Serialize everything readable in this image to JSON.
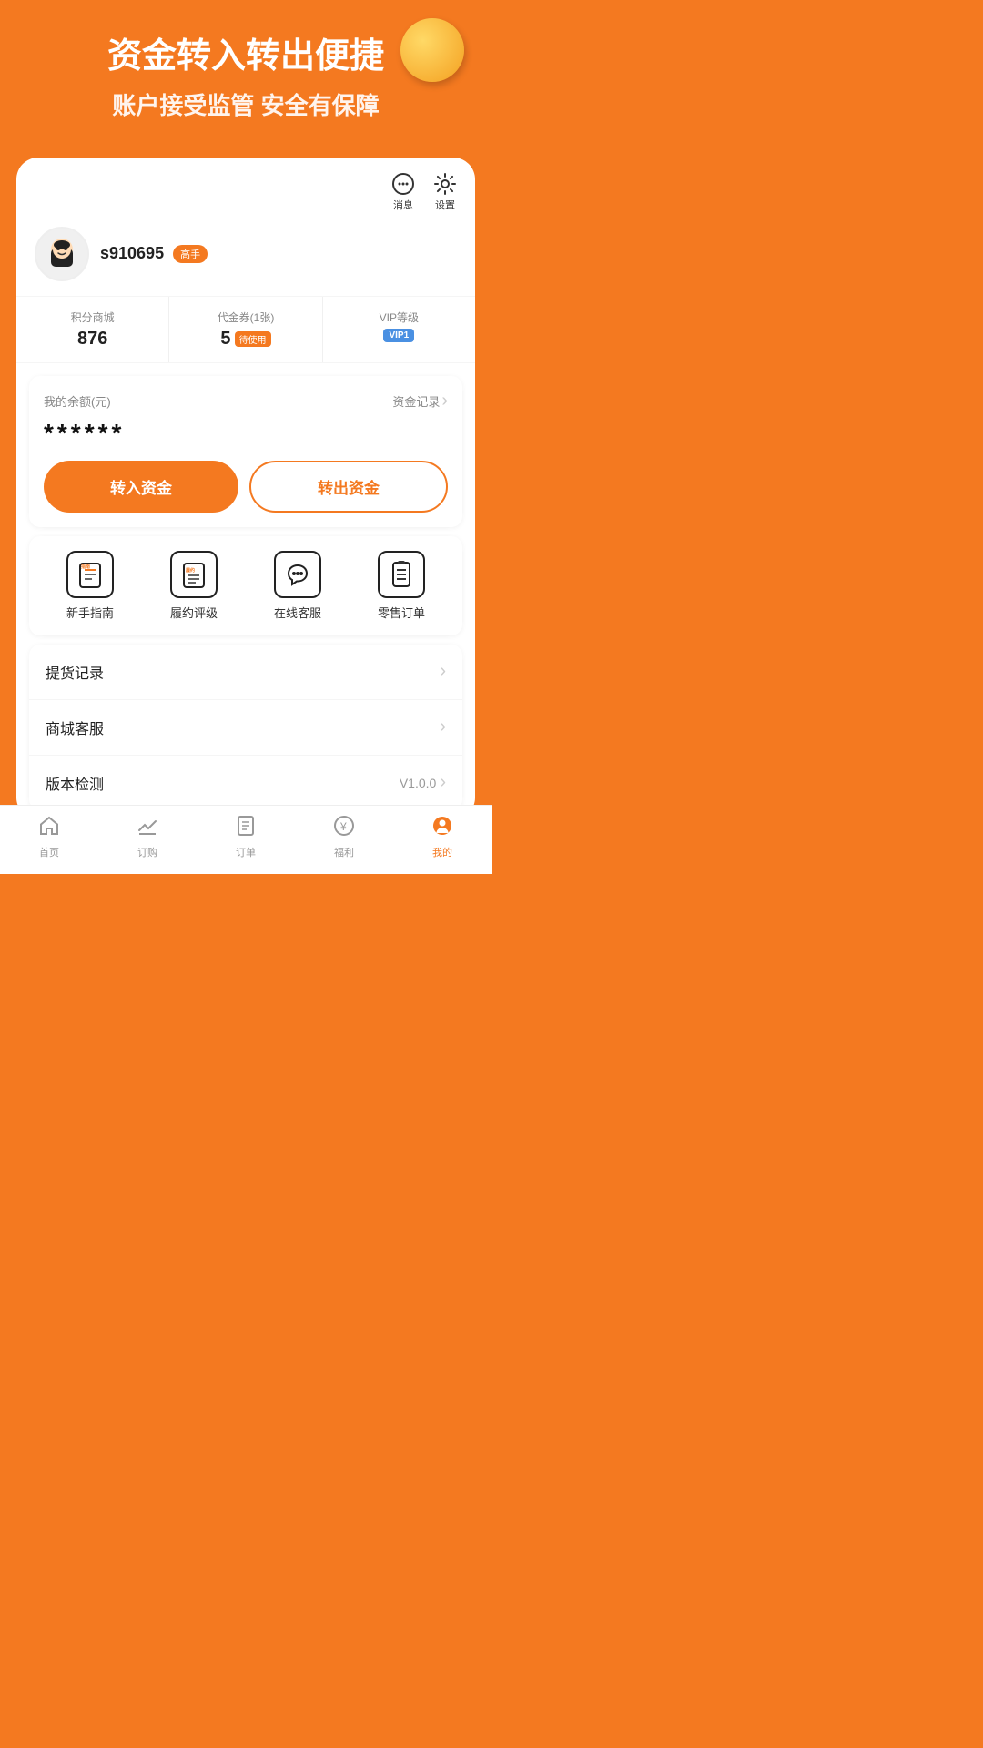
{
  "header": {
    "title": "资金转入转出便捷",
    "subtitle": "账户接受监管 安全有保障"
  },
  "icons": {
    "message_label": "消息",
    "settings_label": "设置"
  },
  "user": {
    "username": "s910695",
    "badge": "高手",
    "avatar_emoji": "😊"
  },
  "stats": {
    "points_label": "积分商城",
    "points_value": "876",
    "voucher_label": "代金券(1张)",
    "voucher_value": "5",
    "voucher_badge": "待使用",
    "vip_label": "VIP等级",
    "vip_badge": "VIP1"
  },
  "balance": {
    "label": "我的余额(元)",
    "link": "资金记录",
    "amount": "******",
    "btn_in": "转入资金",
    "btn_out": "转出资金"
  },
  "quick_actions": [
    {
      "label": "新手指南",
      "icon_text": "指南",
      "icon_inner": ""
    },
    {
      "label": "履约评级",
      "icon_text": "履约",
      "icon_inner": ""
    },
    {
      "label": "在线客服",
      "icon_text": "🎧",
      "icon_inner": ""
    },
    {
      "label": "零售订单",
      "icon_text": "≡",
      "icon_inner": ""
    }
  ],
  "menu_items": [
    {
      "label": "提货记录",
      "right": ""
    },
    {
      "label": "商城客服",
      "right": ""
    },
    {
      "label": "版本检测",
      "right": "V1.0.0"
    }
  ],
  "bottom_nav": [
    {
      "label": "首页",
      "icon": "⌂",
      "active": false
    },
    {
      "label": "订购",
      "icon": "📈",
      "active": false
    },
    {
      "label": "订单",
      "icon": "≡",
      "active": false
    },
    {
      "label": "福利",
      "icon": "¥",
      "active": false
    },
    {
      "label": "我的",
      "icon": "👤",
      "active": true
    }
  ]
}
